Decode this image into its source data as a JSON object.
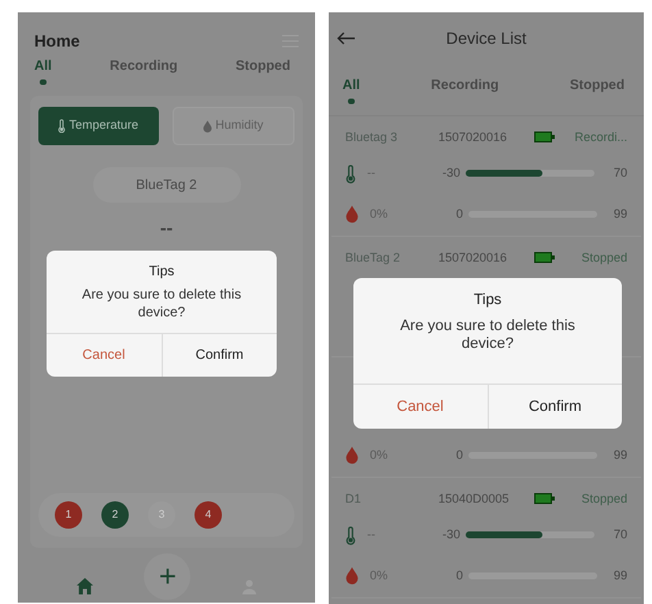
{
  "home_screen": {
    "title": "Home",
    "tabs": [
      {
        "label": "All",
        "selected": true
      },
      {
        "label": "Recording",
        "selected": false
      },
      {
        "label": "Stopped",
        "selected": false
      }
    ],
    "mode_toggle": [
      {
        "label": "Temperature",
        "kind": "temperature",
        "selected": true
      },
      {
        "label": "Humidity",
        "kind": "humidity",
        "selected": false
      }
    ],
    "device_name": "BlueTag 2",
    "reading": "--",
    "device_chips": [
      {
        "label": "1",
        "color": "#8e2a22"
      },
      {
        "label": "2",
        "color": "#1d4631"
      },
      {
        "label": "3",
        "color": "#9a9a9a"
      },
      {
        "label": "4",
        "color": "#8e2a22"
      }
    ],
    "dialog": {
      "title": "Tips",
      "message": "Are you sure to delete this device?",
      "cancel": "Cancel",
      "confirm": "Confirm"
    },
    "add_button": "+"
  },
  "device_list_screen": {
    "title": "Device List",
    "tabs": [
      {
        "label": "All",
        "selected": true
      },
      {
        "label": "Recording",
        "selected": false
      },
      {
        "label": "Stopped",
        "selected": false
      }
    ],
    "devices": [
      {
        "name": "Bluetag 3",
        "id": "1507020016",
        "status": "Recordi...",
        "temperature": {
          "value": "--",
          "min": "-30",
          "max": "70",
          "level": 0.6
        },
        "humidity": {
          "value": "0%",
          "min": "0",
          "max": "99"
        }
      },
      {
        "name": "BlueTag 2",
        "id": "1507020016",
        "status": "Stopped"
      },
      {
        "humidity": {
          "value": "0%",
          "min": "0",
          "max": "99"
        }
      },
      {
        "name": "D1",
        "id": "15040D0005",
        "status": "Stopped",
        "temperature": {
          "value": "--",
          "min": "-30",
          "max": "70",
          "level": 0.6
        },
        "humidity": {
          "value": "0%",
          "min": "0",
          "max": "99"
        }
      }
    ],
    "dialog": {
      "title": "Tips",
      "message": "Are you sure to delete this device?",
      "cancel": "Cancel",
      "confirm": "Confirm"
    }
  }
}
